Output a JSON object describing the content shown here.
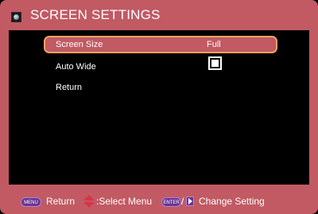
{
  "header": {
    "icon": "monitor-globe-icon",
    "title": "SCREEN SETTINGS"
  },
  "menu": {
    "items": [
      {
        "label": "Screen Size",
        "value": "Full",
        "selected": true
      },
      {
        "label": "Auto Wide",
        "value_type": "checkbox",
        "checked": true
      },
      {
        "label": "Return"
      }
    ]
  },
  "footer": {
    "menu_key": "MENU",
    "menu_action": "Return",
    "updown_icon": "up-down-arrow-icon",
    "select_action": ":Select Menu",
    "enter_key": "ENTER",
    "separator": "/",
    "right_icon": "right-arrow-icon",
    "change_action": "Change Setting"
  },
  "colors": {
    "frame": "#c15a63",
    "panel": "#000000",
    "highlight_border": "#f0a264",
    "key_badge": "#6a3590",
    "arrow_red": "#d9334a"
  }
}
